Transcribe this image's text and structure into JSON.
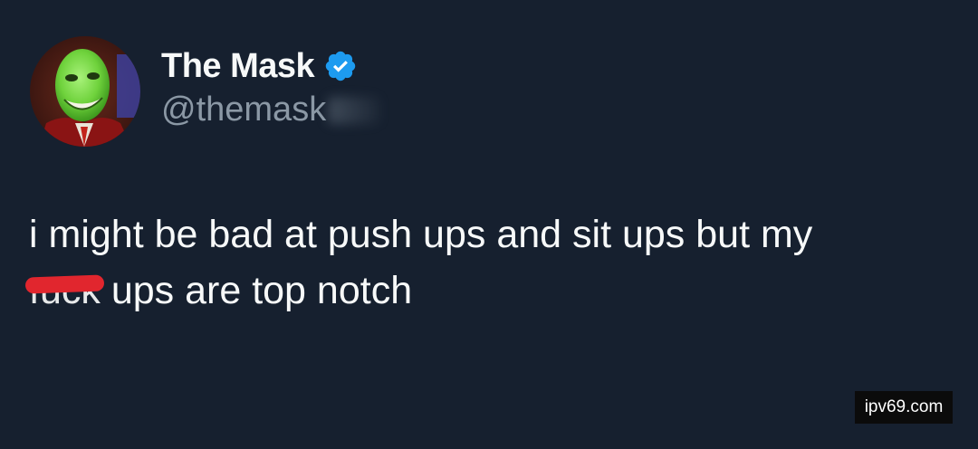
{
  "user": {
    "display_name": "The Mask",
    "handle": "@themask",
    "verified": true,
    "verified_color": "#1d9bf0"
  },
  "tweet": {
    "line1": "i might be bad at push ups and sit ups but my",
    "censored_word": "fuck",
    "line2_rest": " ups are top notch"
  },
  "watermark": {
    "text": "ipv69.com"
  },
  "colors": {
    "background": "#16202f",
    "text": "#f7f9f9",
    "secondary": "#8b98a5",
    "censor": "#e1262e"
  }
}
